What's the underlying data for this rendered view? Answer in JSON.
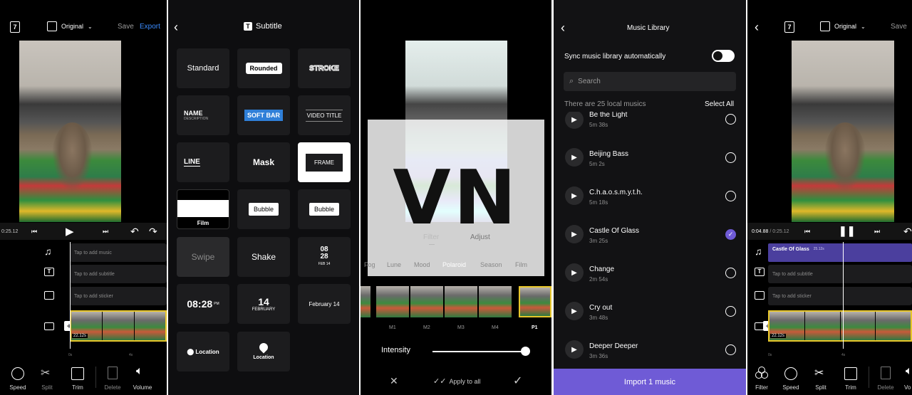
{
  "left_editor": {
    "aspect_label": "Original",
    "save": "Save",
    "export": "Export",
    "time_current": "0:25.12",
    "tracks": [
      "Tap to add music",
      "Tap to add subtitle",
      "Tap to add sticker"
    ],
    "clip_duration": "22.12s",
    "ruler": [
      "0s",
      "4s"
    ],
    "tools": [
      {
        "label": "Speed",
        "icon": "speed-icon"
      },
      {
        "label": "Split",
        "icon": "scissors-icon"
      },
      {
        "label": "Trim",
        "icon": "trim-icon"
      },
      {
        "label": "Delete",
        "icon": "trash-icon"
      },
      {
        "label": "Volume",
        "icon": "volume-icon"
      }
    ]
  },
  "subtitle_panel": {
    "title": "Subtitle",
    "styles": {
      "standard": "Standard",
      "rounded": "Rounded",
      "stroke": "STROKE",
      "name": "NAME",
      "description": "DESCRIPTION",
      "soft_bar": "SOFT BAR",
      "video_title": "VIDEO TITLE",
      "line": "LINE",
      "mask": "Mask",
      "frame": "FRAME",
      "film": "Film",
      "bubble1": "Bubble",
      "bubble2": "Bubble",
      "swipe": "Swipe",
      "shake": "Shake",
      "date_a": "08",
      "date_b": "28",
      "date_c": "FEB 14",
      "time": "08:28",
      "time_pm": "PM",
      "day": "14",
      "month": "FEBRUARY",
      "feb": "February 14",
      "location1": "Location",
      "location2": "Location"
    }
  },
  "filter_panel": {
    "tabs": [
      "Filter",
      "Adjust"
    ],
    "filters": [
      "Fog",
      "Lune",
      "Mood",
      "Polaroid",
      "Season",
      "Film"
    ],
    "selected_filter": "Polaroid",
    "presets": [
      "M1",
      "M2",
      "M3",
      "M4",
      "P1"
    ],
    "intensity_label": "Intensity",
    "intensity": 1.0,
    "apply_all": "Apply to all",
    "logo_text": "VN"
  },
  "music_library": {
    "title": "Music Library",
    "sync_label": "Sync music library automatically",
    "sync_on": false,
    "search_placeholder": "Search",
    "count_text": "There are 25 local musics",
    "select_all": "Select All",
    "songs": [
      {
        "name": "Be the Light",
        "duration": "5m 38s",
        "selected": false
      },
      {
        "name": "Beijing Bass",
        "duration": "5m 2s",
        "selected": false
      },
      {
        "name": "C.h.a.o.s.m.y.t.h.",
        "duration": "5m 18s",
        "selected": false
      },
      {
        "name": "Castle Of Glass",
        "duration": "3m 25s",
        "selected": true
      },
      {
        "name": "Change",
        "duration": "2m 54s",
        "selected": false
      },
      {
        "name": "Cry out",
        "duration": "3m 48s",
        "selected": false
      },
      {
        "name": "Deeper Deeper",
        "duration": "3m 36s",
        "selected": false
      }
    ],
    "import_button": "Import 1 music",
    "accent": "#6f5bd6"
  },
  "right_editor": {
    "aspect_label": "Original",
    "save": "Save",
    "time_current": "0:04.88",
    "time_total": "0:25.12",
    "music_clip": "Castle Of Glass",
    "music_clip_duration": "25.12s",
    "tracks": [
      "Tap to add subtitle",
      "Tap to add sticker"
    ],
    "clip_duration": "22.12s",
    "ruler": [
      "0s",
      "4s"
    ],
    "tools": [
      {
        "label": "Filter",
        "icon": "filter-icon"
      },
      {
        "label": "Speed",
        "icon": "speed-icon"
      },
      {
        "label": "Split",
        "icon": "scissors-icon"
      },
      {
        "label": "Trim",
        "icon": "trim-icon"
      },
      {
        "label": "Delete",
        "icon": "trash-icon"
      },
      {
        "label": "Vo",
        "icon": "volume-icon"
      }
    ]
  }
}
